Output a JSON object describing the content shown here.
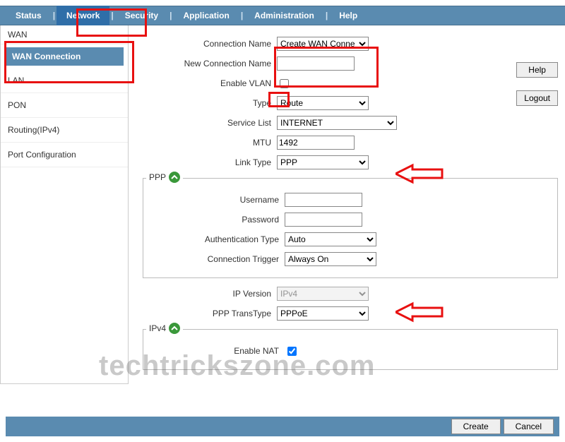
{
  "nav": {
    "items": [
      "Status",
      "Network",
      "Security",
      "Application",
      "Administration",
      "Help"
    ],
    "active": "Network"
  },
  "sidebar": {
    "wan_header": "WAN",
    "wan_sub": "WAN Connection",
    "items": [
      "LAN",
      "PON",
      "Routing(IPv4)",
      "Port Configuration"
    ]
  },
  "buttons": {
    "help": "Help",
    "logout": "Logout",
    "create": "Create",
    "cancel": "Cancel"
  },
  "form": {
    "connection_name_label": "Connection Name",
    "connection_name_value": "Create WAN Conne",
    "new_connection_name_label": "New Connection Name",
    "new_connection_name_value": "",
    "enable_vlan_label": "Enable VLAN",
    "enable_vlan_checked": false,
    "type_label": "Type",
    "type_value": "Route",
    "service_list_label": "Service List",
    "service_list_value": "INTERNET",
    "mtu_label": "MTU",
    "mtu_value": "1492",
    "link_type_label": "Link Type",
    "link_type_value": "PPP"
  },
  "ppp": {
    "legend": "PPP",
    "username_label": "Username",
    "username_value": "",
    "password_label": "Password",
    "password_value": "",
    "auth_type_label": "Authentication Type",
    "auth_type_value": "Auto",
    "conn_trigger_label": "Connection Trigger",
    "conn_trigger_value": "Always On"
  },
  "below_ppp": {
    "ip_version_label": "IP Version",
    "ip_version_value": "IPv4",
    "ppp_transtype_label": "PPP TransType",
    "ppp_transtype_value": "PPPoE"
  },
  "ipv4": {
    "legend": "IPv4",
    "enable_nat_label": "Enable NAT",
    "enable_nat_checked": true
  },
  "watermark": "techtrickszone.com"
}
